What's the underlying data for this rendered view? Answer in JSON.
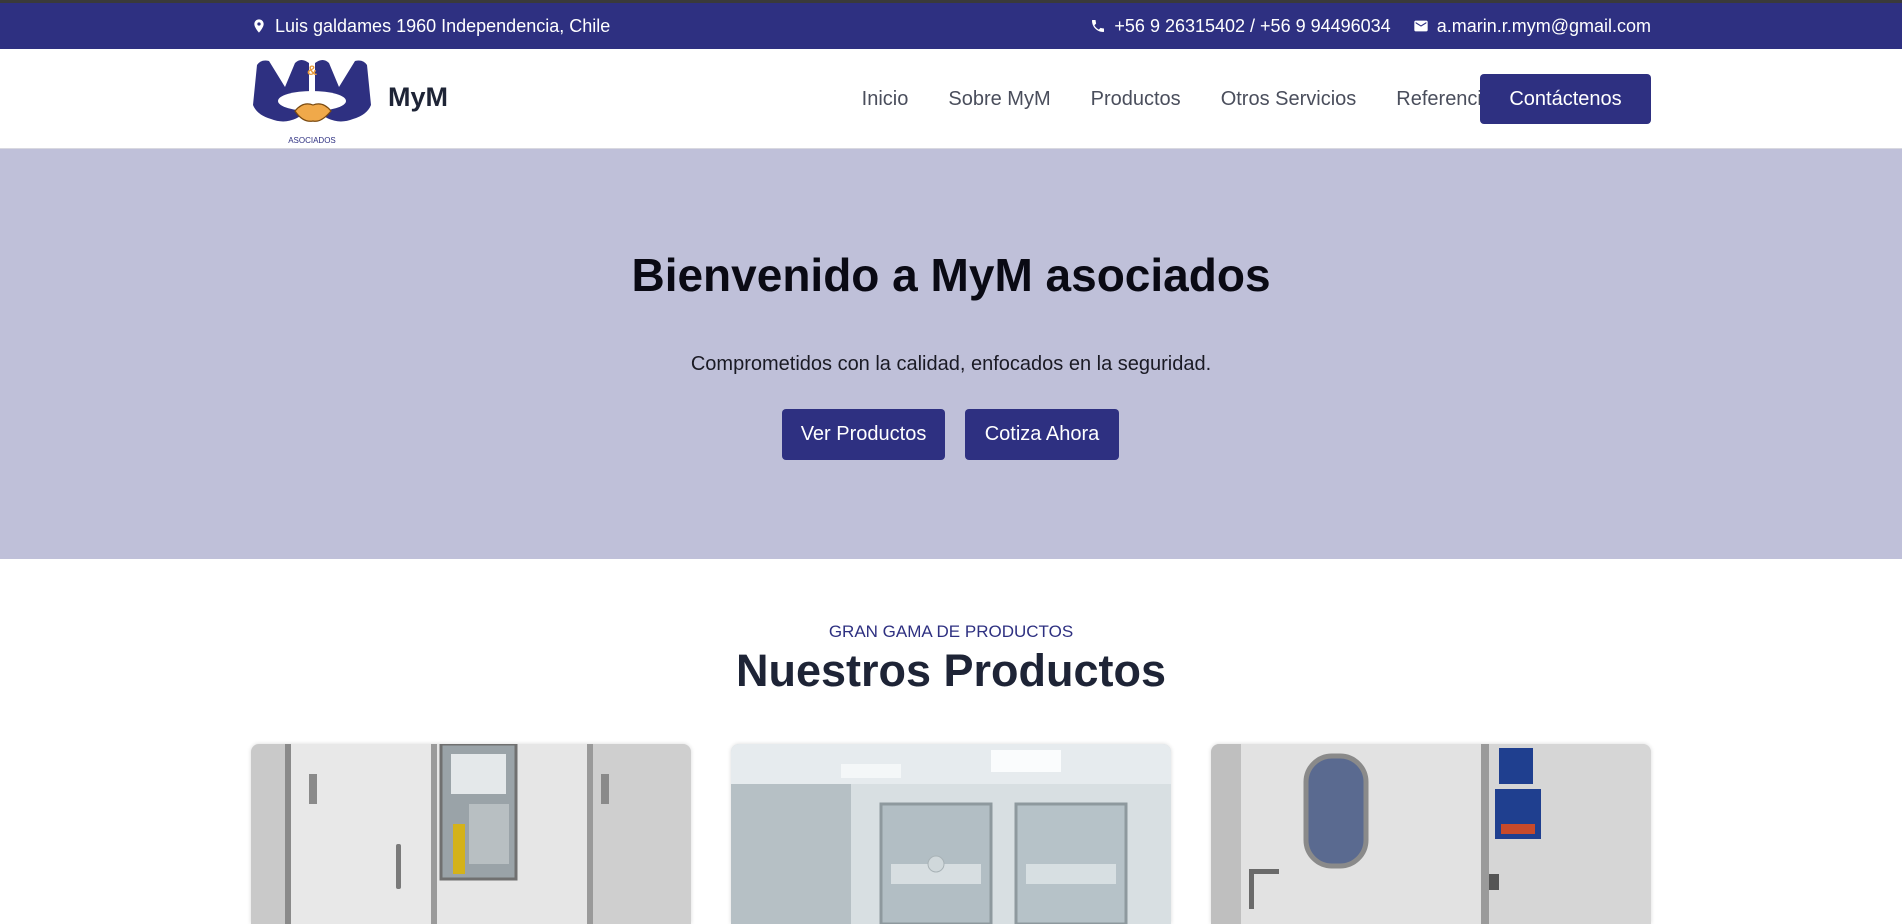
{
  "topbar": {
    "address": "Luis galdames 1960 Independencia, Chile",
    "phones": "+56 9 26315402 / +56 9 94496034",
    "email": "a.marin.r.mym@gmail.com"
  },
  "header": {
    "brand": "MyM",
    "logo_text": "ASOCIADOS",
    "nav": [
      "Inicio",
      "Sobre MyM",
      "Productos",
      "Otros Servicios",
      "Referencias"
    ],
    "contact_label": "Contáctenos"
  },
  "hero": {
    "title": "Bienvenido a MyM asociados",
    "subtitle": "Comprometidos con la calidad, enfocados en la seguridad.",
    "buttons": [
      "Ver Productos",
      "Cotiza Ahora"
    ]
  },
  "products": {
    "eyebrow": "GRAN GAMA DE PRODUCTOS",
    "title": "Nuestros Productos",
    "cards": [
      "product-door-image-1",
      "product-cleanroom-image-2",
      "product-door-image-3"
    ]
  },
  "colors": {
    "brand": "#2e3081",
    "hero_bg": "#bfc0d9",
    "heading": "#1e2436"
  },
  "icons": [
    "location-pin-icon",
    "phone-icon",
    "mail-icon"
  ]
}
